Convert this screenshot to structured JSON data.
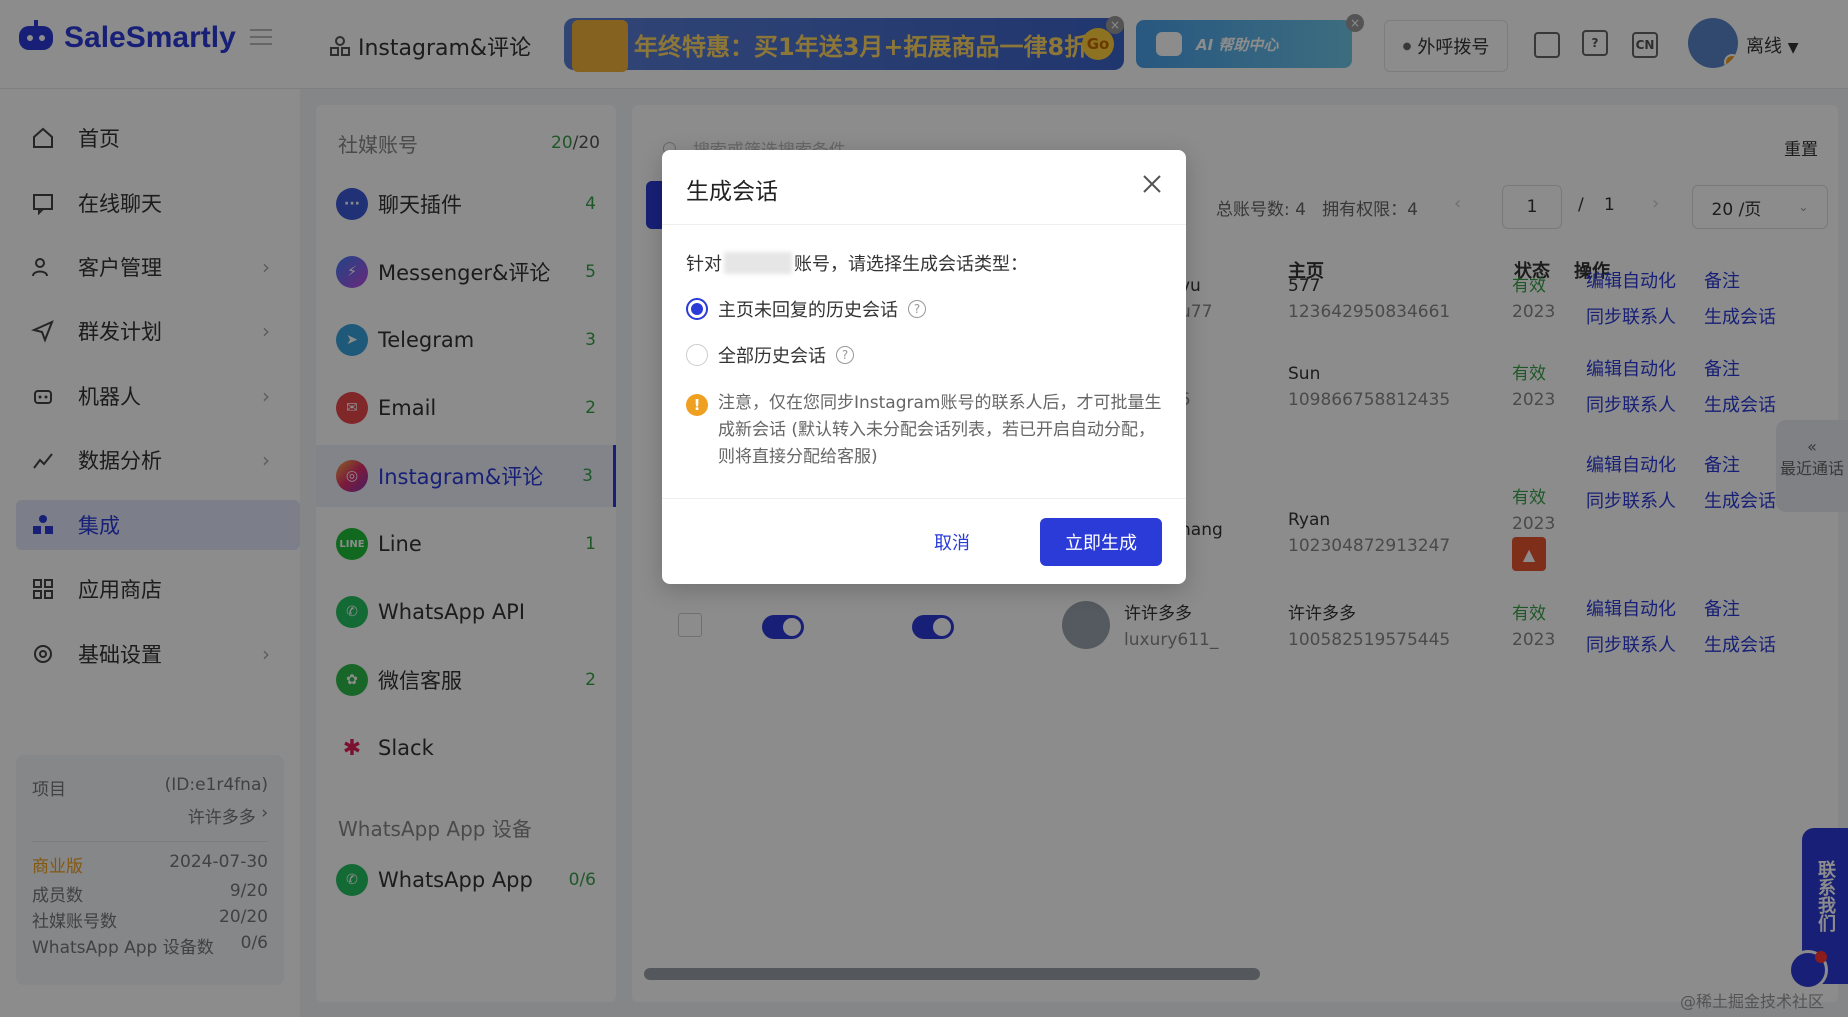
{
  "header": {
    "logo_text": "SaleSmartly",
    "page_title": "Instagram&评论",
    "banner_promo": "年终特惠：买1年送3月+拓展商品一律8折",
    "banner_promo_go": "Go",
    "banner_ai": "AI 帮助中心",
    "dial_button": "外呼拨号",
    "lang_icon_text": "CN",
    "user_status": "离线"
  },
  "sidebar": {
    "items": [
      {
        "label": "首页",
        "icon": "home-icon"
      },
      {
        "label": "在线聊天",
        "icon": "chat-icon"
      },
      {
        "label": "客户管理",
        "icon": "users-icon"
      },
      {
        "label": "群发计划",
        "icon": "send-icon"
      },
      {
        "label": "机器人",
        "icon": "robot-icon"
      },
      {
        "label": "数据分析",
        "icon": "analytics-icon"
      },
      {
        "label": "集成",
        "icon": "integration-icon"
      },
      {
        "label": "应用商店",
        "icon": "apps-icon"
      },
      {
        "label": "基础设置",
        "icon": "settings-icon"
      }
    ],
    "project": {
      "label": "项目",
      "id": "(ID:e1r4fna)",
      "name": "许许多多",
      "plan": "商业版",
      "expiry": "2024-07-30",
      "members_label": "成员数",
      "members_value": "9/20",
      "social_label": "社媒账号数",
      "social_value": "20/20",
      "wa_label": "WhatsApp App 设备数",
      "wa_value": "0/6"
    }
  },
  "panel": {
    "header_label": "社媒账号",
    "header_used": "20",
    "header_total": "/20",
    "items": [
      {
        "label": "聊天插件",
        "count": "4"
      },
      {
        "label": "Messenger&评论",
        "count": "5"
      },
      {
        "label": "Telegram",
        "count": "3"
      },
      {
        "label": "Email",
        "count": "2"
      },
      {
        "label": "Instagram&评论",
        "count": "3"
      },
      {
        "label": "Line",
        "count": "1"
      },
      {
        "label": "WhatsApp API",
        "count": ""
      },
      {
        "label": "微信客服",
        "count": "2"
      },
      {
        "label": "Slack",
        "count": ""
      }
    ],
    "section2_label": "WhatsApp App 设备",
    "wa_app": {
      "label": "WhatsApp App",
      "count": "0/6"
    }
  },
  "main": {
    "search_placeholder": "搜索或筛选搜索条件",
    "reset_label": "重置",
    "total_accounts": "总账号数: 4",
    "permission": "拥有权限：4",
    "page_current": "1",
    "page_sep": "/",
    "page_total": "1",
    "page_size": "20 /页",
    "columns": {
      "home": "主页",
      "status": "状态",
      "actions": "操作"
    },
    "rows": [
      {
        "name_tail": "vu",
        "name_tail2": "u77",
        "home_name": "577",
        "home_id": "123642950834661",
        "status": "有效",
        "status_date": "2023"
      },
      {
        "name_tail": "",
        "name_tail2": "5",
        "home_name": "Sun",
        "home_id": "109866758812435",
        "status": "有效",
        "status_date": "2023"
      },
      {
        "name_tail": "hang",
        "name_tail2": "",
        "home_name": "Ryan",
        "home_id": "102304872913247",
        "status": "有效",
        "status_date": "2023"
      },
      {
        "name_tail": "许许多多",
        "name_tail2": "luxury611_",
        "home_name": "许许多多",
        "home_id": "100582519575445",
        "status": "有效",
        "status_date": "2023"
      }
    ],
    "action_edit": "编辑自动化",
    "action_note": "备注",
    "action_sync": "同步联系人",
    "action_generate": "生成会话"
  },
  "side_widgets": {
    "recent_calls": "最近通话",
    "contact_us": "联系我们",
    "watermark": "@稀土掘金技术社区"
  },
  "modal": {
    "title": "生成会话",
    "prompt_prefix": "针对",
    "prompt_suffix": "账号，请选择生成会话类型：",
    "option1": "主页未回复的历史会话",
    "option2": "全部历史会话",
    "notice": "注意，仅在您同步Instagram账号的联系人后，才可批量生成新会话 (默认转入未分配会话列表，若已开启自动分配，则将直接分配给客服)",
    "cancel": "取消",
    "confirm": "立即生成"
  },
  "colors": {
    "accent": "#2a3bd8",
    "success": "#3aa04a",
    "warning": "#f0a020"
  }
}
